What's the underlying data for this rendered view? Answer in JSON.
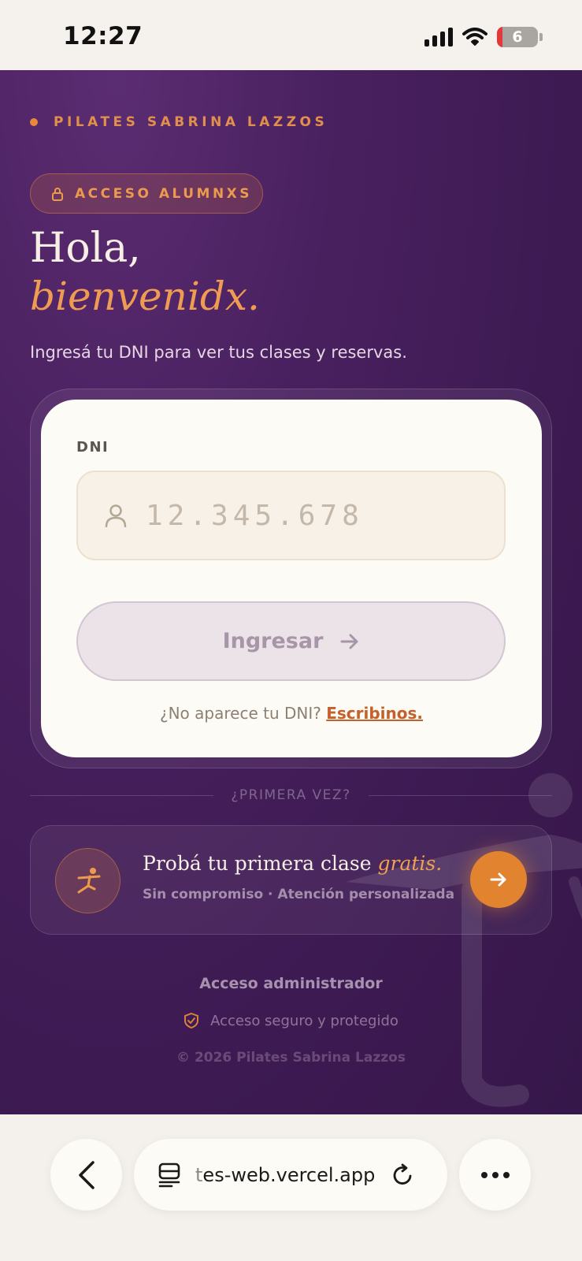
{
  "status_bar": {
    "time": "12:27",
    "battery_level": "6"
  },
  "brand": {
    "name": "PILATES SABRINA LAZZOS",
    "accent": "#e8893a"
  },
  "pill": {
    "label": "ACCESO ALUMNXS",
    "icon": "lock-icon"
  },
  "hero": {
    "line1": "Hola,",
    "line2": "bienvenidx.",
    "subtitle": "Ingresá tu DNI para ver tus clases y reservas."
  },
  "login": {
    "dni_label": "DNI",
    "dni_placeholder": "12.345.678",
    "dni_value": "",
    "submit_label": "Ingresar",
    "help_text": "¿No aparece tu DNI?",
    "help_link": "Escribinos."
  },
  "divider": {
    "label": "¿PRIMERA VEZ?"
  },
  "trial": {
    "title_main": "Probá tu primera clase",
    "title_accent": "gratis.",
    "subtitle": "Sin compromiso · Atención personalizada",
    "button_color": "#e2832f"
  },
  "footer": {
    "admin_link": "Acceso administrador",
    "secure_text": "Acceso seguro y protegido",
    "copyright": "© 2026 Pilates Sabrina Lazzos"
  },
  "browser": {
    "url_faded": "t",
    "url_main": "es-web.vercel.app"
  },
  "colors": {
    "bg_purple": "#48205e",
    "card_bg": "#fdfbf6",
    "orange": "#e2832f"
  }
}
